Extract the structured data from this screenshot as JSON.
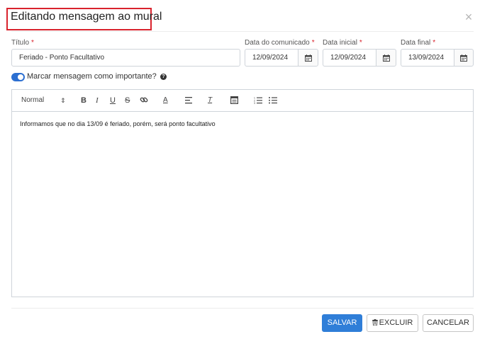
{
  "modal": {
    "title": "Editando mensagem ao mural",
    "close_glyph": "×"
  },
  "form": {
    "titulo": {
      "label": "Título",
      "value": "Feriado - Ponto Facultativo"
    },
    "data_comunicado": {
      "label": "Data do comunicado",
      "value": "12/09/2024"
    },
    "data_inicial": {
      "label": "Data inicial",
      "value": "12/09/2024"
    },
    "data_final": {
      "label": "Data final",
      "value": "13/09/2024"
    },
    "required_mark": "*",
    "important_toggle": {
      "label": "Marcar mensagem como importante?",
      "checked": true
    },
    "help_glyph": "?"
  },
  "editor": {
    "toolbar": {
      "format_select": "Normal",
      "bold": "B",
      "italic": "I",
      "underline": "U",
      "strike": "S",
      "color": "A",
      "clear_format": "T"
    },
    "content": "Informamos que no dia 13/09 é feriado, porém, será ponto facultativo"
  },
  "footer": {
    "save_label": "SALVAR",
    "delete_label": "EXCLUIR",
    "cancel_label": "CANCELAR"
  },
  "colors": {
    "primary": "#2f7ed8",
    "required": "#d9232d",
    "toggle_on": "#2c6fd1"
  },
  "icons": {
    "calendar": "calendar-icon",
    "trash": "trash-icon",
    "close": "close-icon",
    "help": "question-circle-icon"
  }
}
